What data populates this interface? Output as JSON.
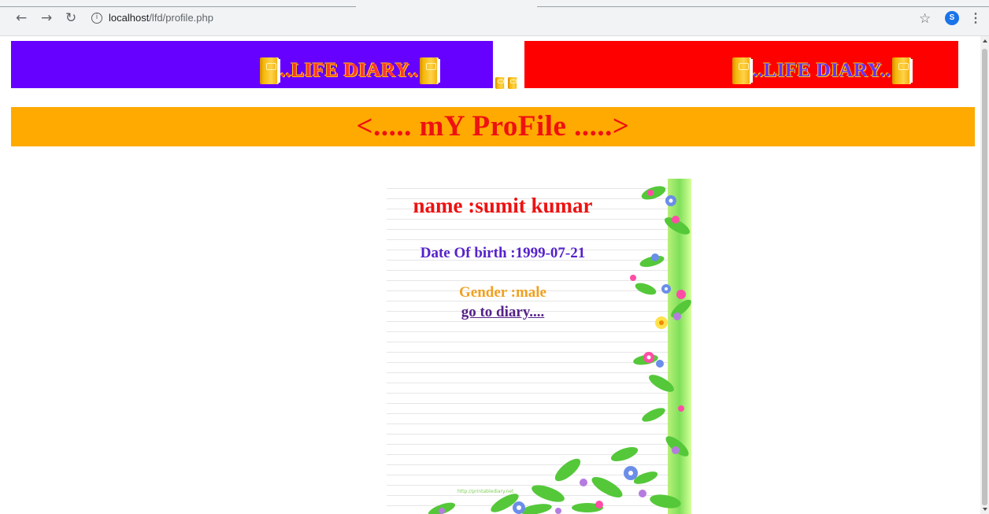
{
  "browser": {
    "url_host": "localhost",
    "url_path": "/lfd/profile.php",
    "profile_initial": "S"
  },
  "banner": {
    "left_text": "..LIFE DIARY..",
    "right_text": "..LIFE DIARY..",
    "left_bg": "#6600ff",
    "right_bg": "#ff0000"
  },
  "heading": {
    "text": "<..... mY ProFile .....>",
    "bg": "#ffaa00"
  },
  "profile": {
    "name": "name :sumit kumar",
    "dob": "Date Of birth :1999-07-21",
    "gender": "Gender :male",
    "diary_link": "go to diary...."
  },
  "credit": "http://printablediary.net"
}
